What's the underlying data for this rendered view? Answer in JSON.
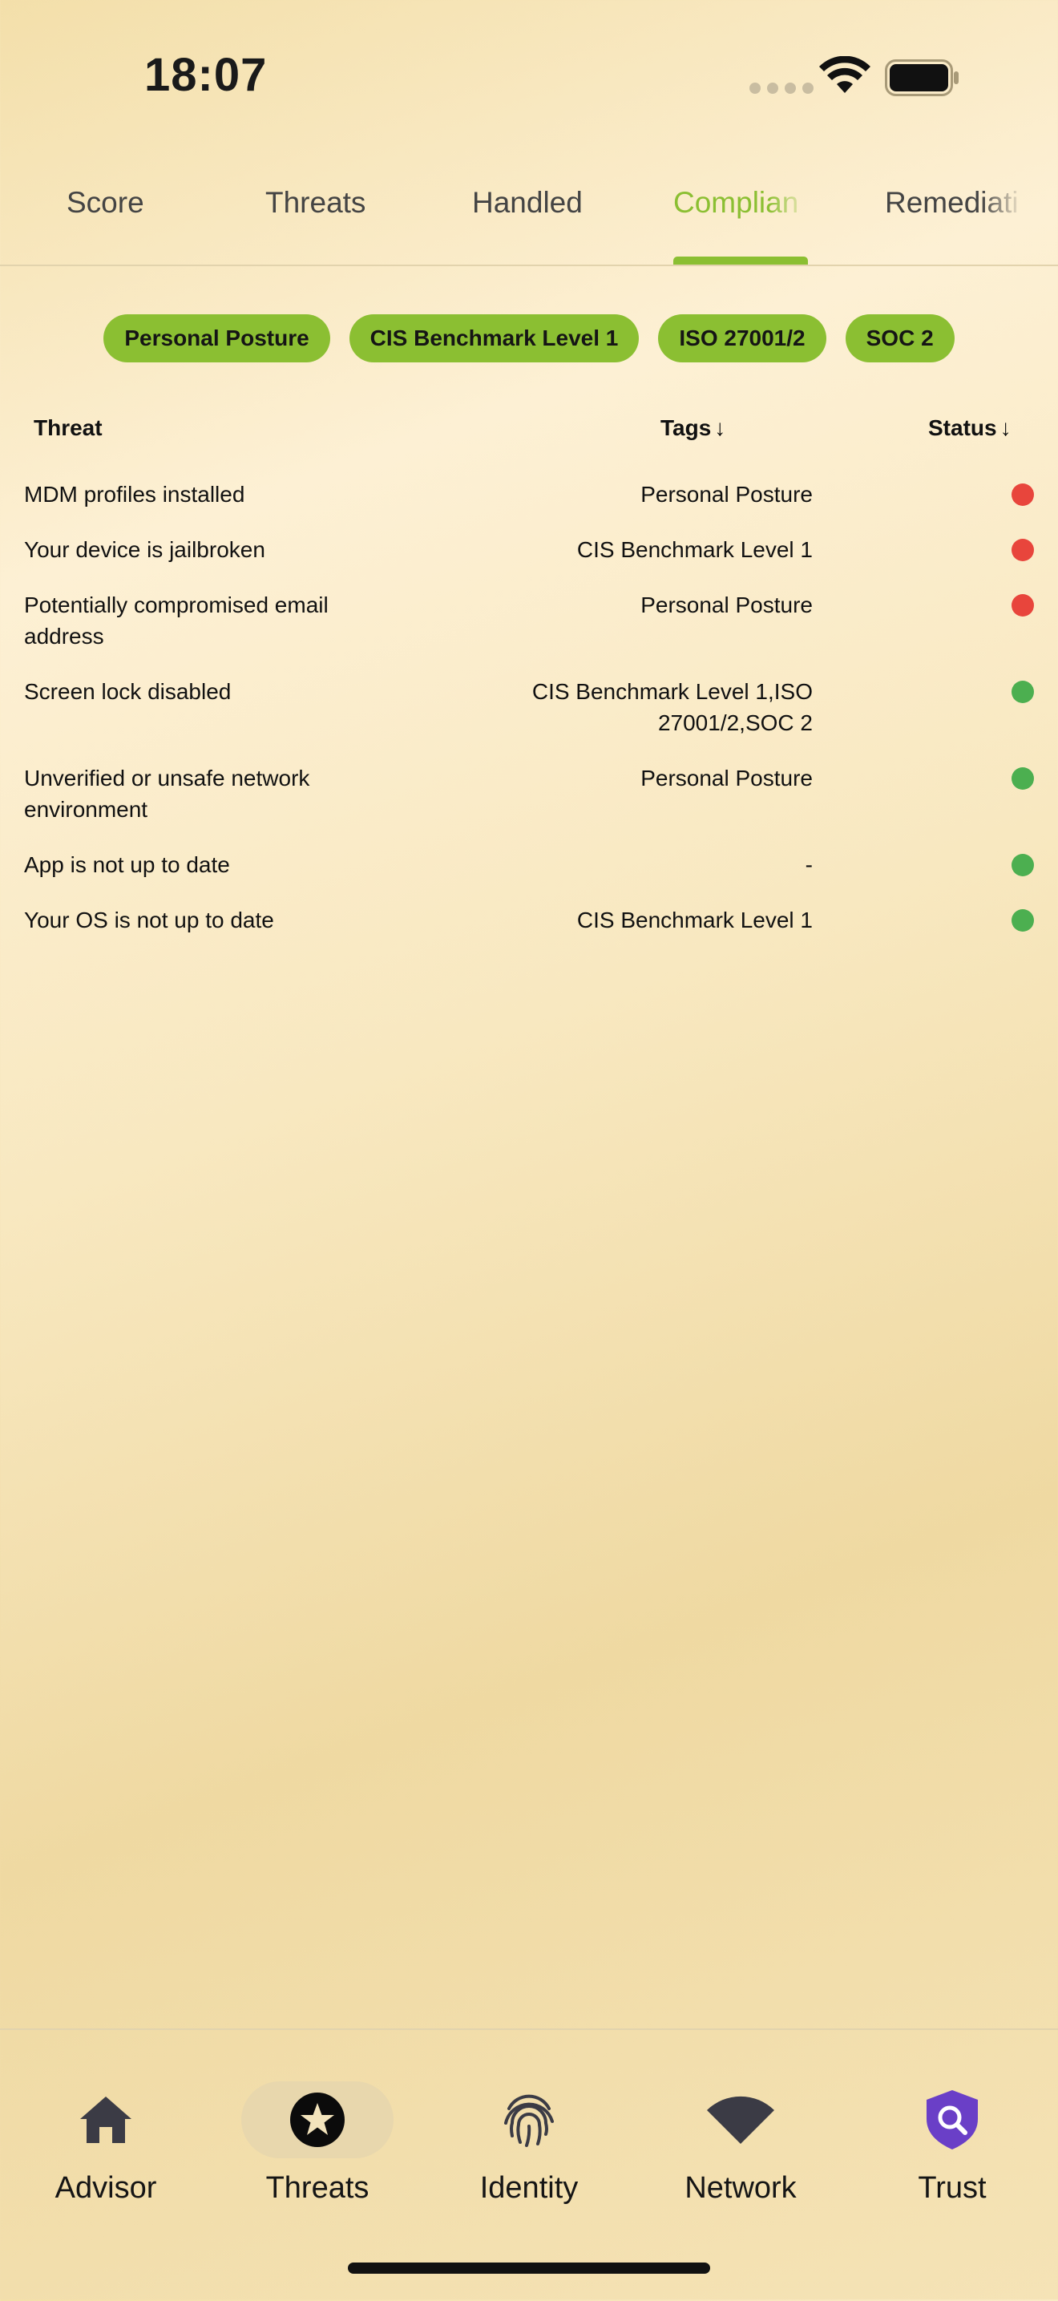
{
  "status_bar": {
    "time": "18:07"
  },
  "top_tabs": [
    {
      "label": "Score"
    },
    {
      "label": "Threats"
    },
    {
      "label": "Handled"
    },
    {
      "label": "Complian"
    },
    {
      "label": "Remediati"
    }
  ],
  "active_tab": "Compliance",
  "accent_color": "#8bbf32",
  "chips": [
    {
      "label": "Personal Posture"
    },
    {
      "label": "CIS Benchmark Level 1"
    },
    {
      "label": "ISO 27001/2"
    },
    {
      "label": "SOC 2"
    }
  ],
  "table": {
    "headers": {
      "threat": "Threat",
      "tags": "Tags",
      "status": "Status",
      "sort_arrow": "↓"
    },
    "rows": [
      {
        "threat": "MDM profiles installed",
        "tags": "Personal Posture",
        "status": "red"
      },
      {
        "threat": "Your device is jailbroken",
        "tags": "CIS Benchmark Level 1",
        "status": "red"
      },
      {
        "threat": "Potentially compromised email address",
        "tags": "Personal Posture",
        "status": "red"
      },
      {
        "threat": "Screen lock disabled",
        "tags": "CIS Benchmark Level 1,ISO 27001/2,SOC 2",
        "status": "green"
      },
      {
        "threat": "Unverified or unsafe network environment",
        "tags": "Personal Posture",
        "status": "green"
      },
      {
        "threat": "App is not up to date",
        "tags": "-",
        "status": "green"
      },
      {
        "threat": "Your OS is not up to date",
        "tags": "CIS Benchmark Level 1",
        "status": "green"
      }
    ],
    "status_colors": {
      "red": "#e8453c",
      "green": "#4caf50"
    }
  },
  "bottom_nav": [
    {
      "label": "Advisor",
      "icon": "home-icon"
    },
    {
      "label": "Threats",
      "icon": "star-icon",
      "selected": true
    },
    {
      "label": "Identity",
      "icon": "fingerprint-icon"
    },
    {
      "label": "Network",
      "icon": "wifi-icon"
    },
    {
      "label": "Trust",
      "icon": "shield-search-icon"
    }
  ]
}
